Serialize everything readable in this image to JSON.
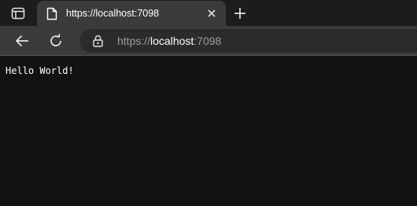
{
  "tab": {
    "title": "https://localhost:7098"
  },
  "address_bar": {
    "scheme": "https://",
    "host": "localhost",
    "port": ":7098"
  },
  "page": {
    "text": "Hello World!"
  },
  "icons": {
    "tab_actions": "tab-actions-icon",
    "favicon": "document-icon",
    "tab_close": "close-icon",
    "new_tab": "plus-icon",
    "back": "back-arrow-icon",
    "refresh": "refresh-icon",
    "site_info": "lock-icon"
  },
  "colors": {
    "tab_strip_bg": "#1c1c1c",
    "active_tab_bg": "#3b3b3b",
    "address_bar_bg": "#2b2b2b",
    "page_bg": "#121212",
    "text": "#ffffff",
    "muted_text": "#9e9e9e"
  }
}
